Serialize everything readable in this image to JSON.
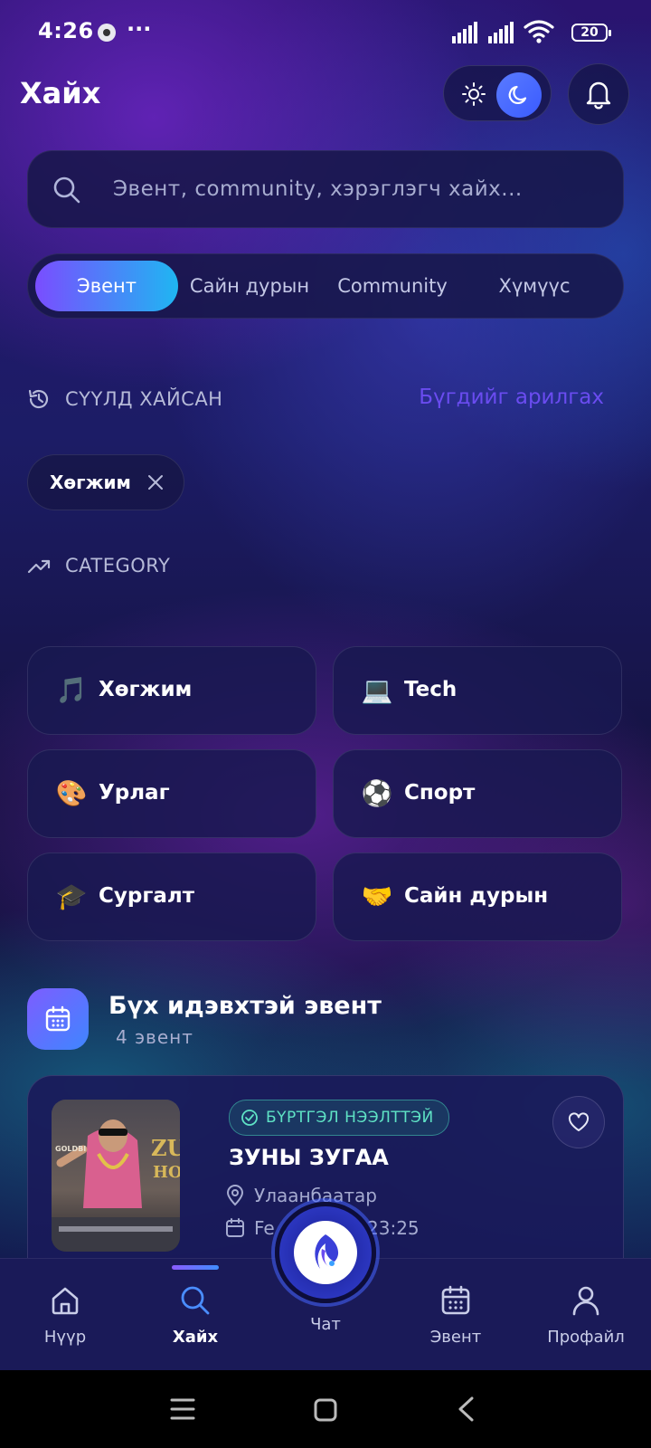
{
  "status_bar": {
    "time": "4:26",
    "more": "···",
    "battery": "20"
  },
  "header": {
    "title": "Хайх"
  },
  "search": {
    "placeholder": "Эвент, community, хэрэглэгч хайх..."
  },
  "tabs": [
    {
      "label": "Эвент",
      "active": true
    },
    {
      "label": "Сайн дурын",
      "active": false
    },
    {
      "label": "Community",
      "active": false
    },
    {
      "label": "Хүмүүс",
      "active": false
    }
  ],
  "recent": {
    "heading": "СҮҮЛД ХАЙСАН",
    "clear_label": "Бүгдийг арилгах",
    "chips": [
      {
        "label": "Хөгжим"
      }
    ]
  },
  "category": {
    "heading": "CATEGORY",
    "items": [
      {
        "emoji": "🎵",
        "label": "Хөгжим"
      },
      {
        "emoji": "💻",
        "label": "Tech"
      },
      {
        "emoji": "🎨",
        "label": "Урлаг"
      },
      {
        "emoji": "⚽",
        "label": "Спорт"
      },
      {
        "emoji": "🎓",
        "label": "Сургалт"
      },
      {
        "emoji": "🤝",
        "label": "Сайн дурын"
      }
    ]
  },
  "events": {
    "heading": "Бүх идэвхтэй эвент",
    "count_label": "4 эвент",
    "cards": [
      {
        "badge": "БҮРТГЭЛ НЭЭЛТТЭЙ",
        "title": "ЗУНЫ ЗУГАА",
        "location": "Улаанбаатар",
        "date_visible_prefix": "Fe",
        "date_visible_suffix": "23:25",
        "poster_text": "ZUN",
        "poster_text2": "HOM",
        "poster_caption": "GOLDBI"
      }
    ]
  },
  "nav": {
    "items": [
      {
        "label": "Нүүр",
        "icon": "home-icon"
      },
      {
        "label": "Хайх",
        "icon": "search-icon",
        "active": true
      },
      {
        "label": "Чат",
        "icon": "chat-logo-icon"
      },
      {
        "label": "Эвент",
        "icon": "calendar-icon"
      },
      {
        "label": "Профайл",
        "icon": "user-icon"
      }
    ]
  },
  "colors": {
    "accent": "#7a4dff",
    "accent2": "#1fb6f2",
    "badge_green": "#5fe3c5",
    "clear_link": "#6a4cf0"
  }
}
